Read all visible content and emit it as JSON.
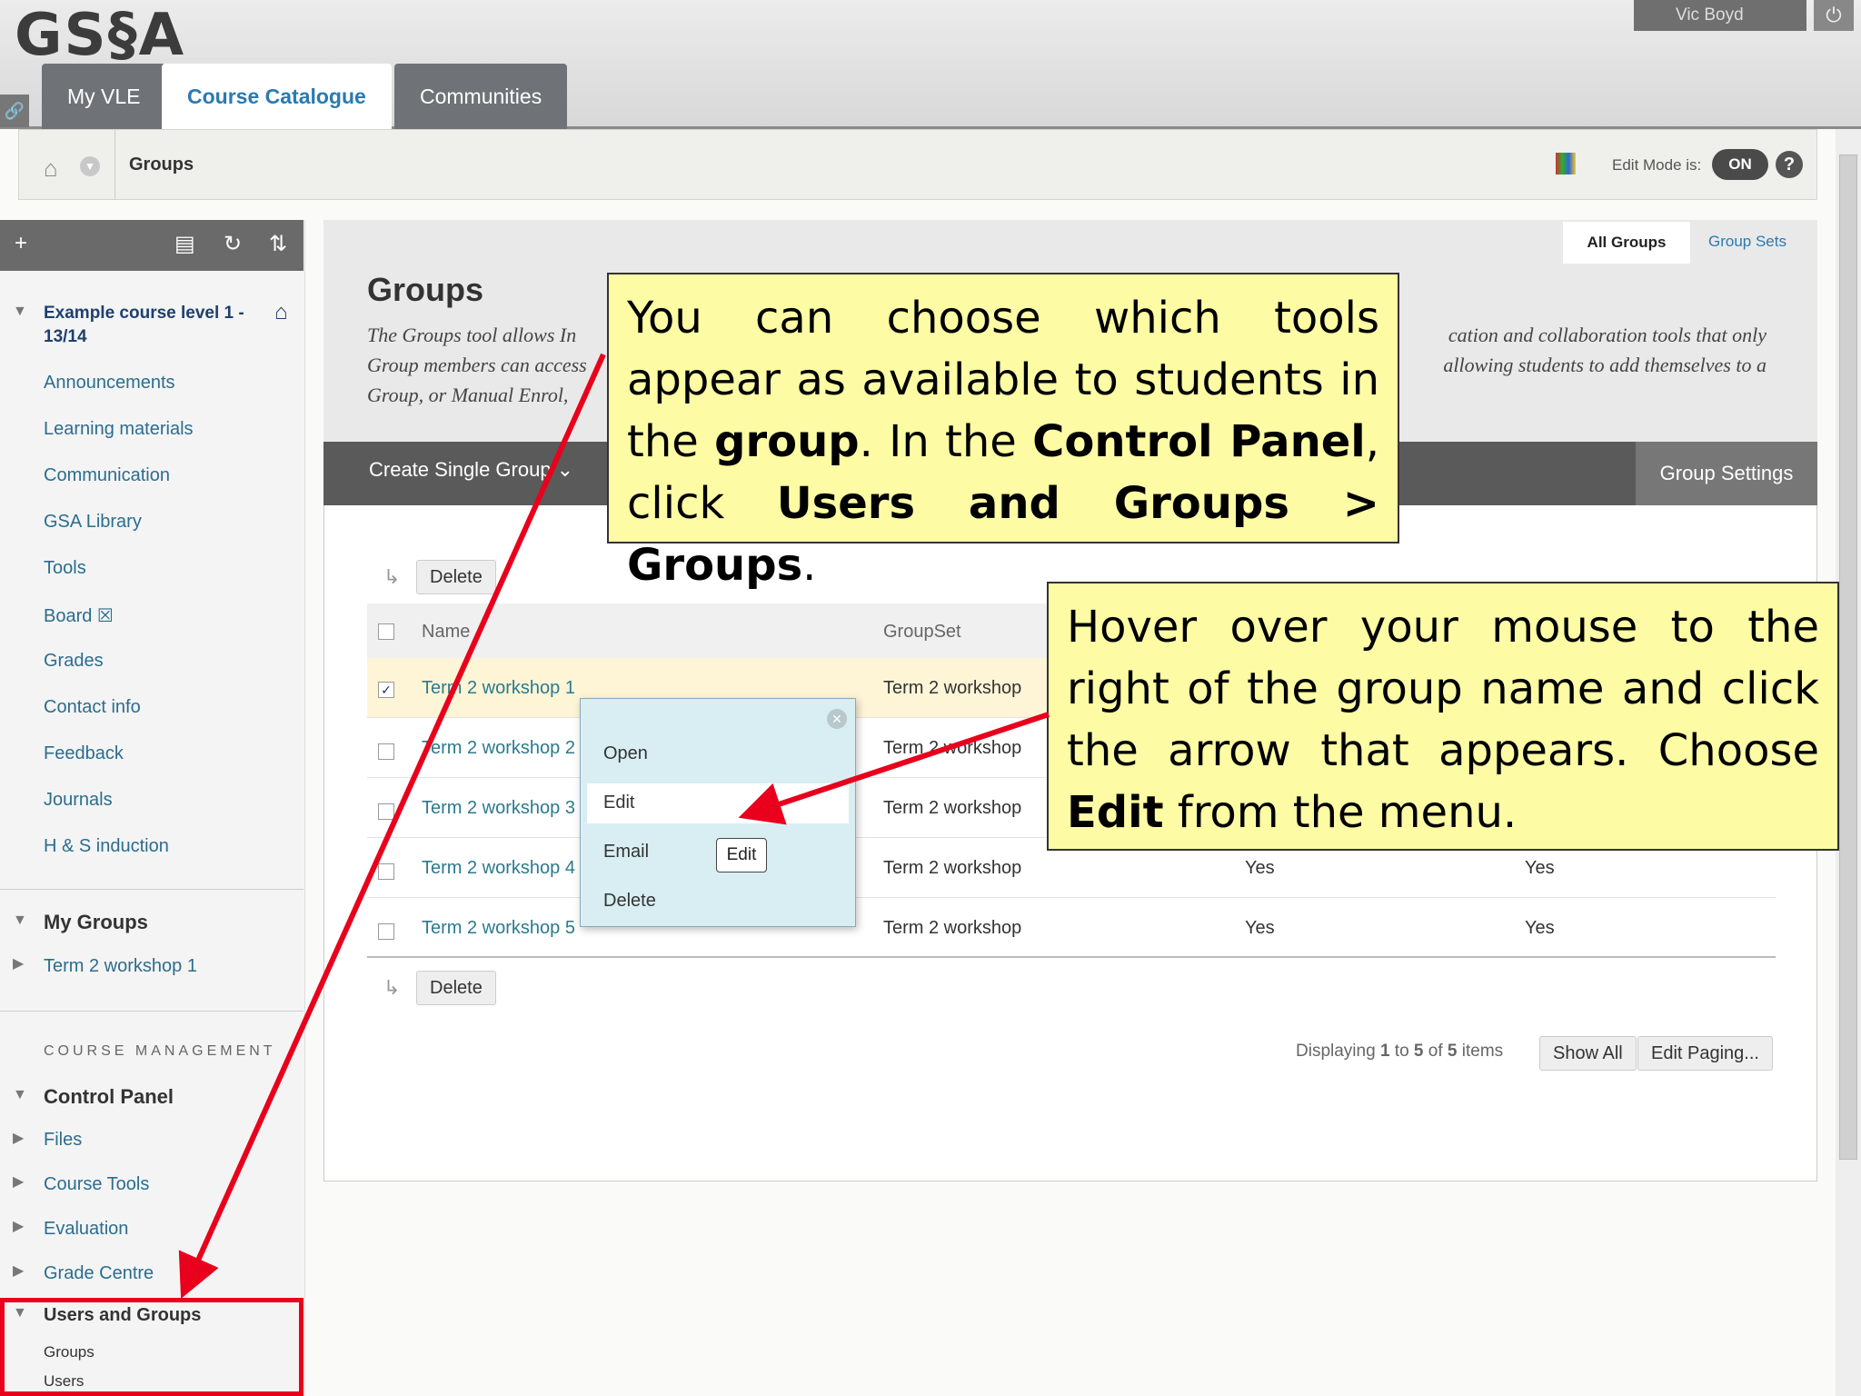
{
  "header": {
    "logo": "GS§A",
    "tabs": [
      "My VLE",
      "Course Catalogue",
      "Communities"
    ],
    "user": "Vic Boyd",
    "power_icon": "power-icon"
  },
  "breadcrumb": {
    "current": "Groups",
    "edit_mode_label": "Edit Mode is:",
    "edit_mode_value": "ON",
    "help": "?"
  },
  "sidebar": {
    "course_title_line1": "Example course level 1 -",
    "course_title_line2": "13/14",
    "links": [
      "Announcements",
      "Learning materials",
      "Communication",
      "GSA Library",
      "Tools",
      "Board ☒",
      "Grades",
      "Contact info",
      "Feedback",
      "Journals",
      "H & S induction"
    ],
    "my_groups": "My Groups",
    "my_group_item": "Term 2 workshop 1",
    "course_management": "COURSE MANAGEMENT",
    "control_panel": "Control Panel",
    "cp_items": [
      "Files",
      "Course Tools",
      "Evaluation",
      "Grade Centre",
      "Users and Groups"
    ],
    "sub_items": [
      "Groups",
      "Users"
    ]
  },
  "main": {
    "title": "Groups",
    "desc_line1": "The Groups tool allows In",
    "desc_line1_end": "cation and collaboration tools that only",
    "desc_line2": "Group members can access",
    "desc_line2_end": "allowing students to add themselves to a",
    "desc_line3": "Group, or Manual Enrol,",
    "tab_all": "All Groups",
    "tab_sets": "Group Sets",
    "create": "Create Single Group ⌄",
    "settings": "Group Settings",
    "delete": "Delete",
    "col_name": "Name",
    "col_groupset": "GroupSet",
    "rows": [
      {
        "name": "Term 2 workshop 1",
        "set": "Term 2 workshop",
        "c3": "",
        "c4": "",
        "checked": true
      },
      {
        "name": "Term 2 workshop 2",
        "set": "Term 2 workshop",
        "c3": "",
        "c4": "",
        "checked": false
      },
      {
        "name": "Term 2 workshop 3",
        "set": "Term 2 workshop",
        "c3": "",
        "c4": "",
        "checked": false
      },
      {
        "name": "Term 2 workshop 4",
        "set": "Term 2 workshop",
        "c3": "Yes",
        "c4": "Yes",
        "checked": false
      },
      {
        "name": "Term 2 workshop 5",
        "set": "Term 2 workshop",
        "c3": "Yes",
        "c4": "Yes",
        "checked": false
      }
    ],
    "paging_prefix": "Displaying ",
    "paging_from": "1",
    "paging_mid": " to ",
    "paging_to": "5",
    "paging_of": " of ",
    "paging_total": "5",
    "paging_suffix": " items",
    "show_all": "Show All",
    "edit_paging": "Edit Paging..."
  },
  "context_menu": {
    "items": [
      "Open",
      "Edit",
      "Email",
      "Delete"
    ],
    "tooltip": "Edit"
  },
  "callouts": {
    "one": {
      "p1": "You can choose which tools appear as available to students in the ",
      "b1": "group",
      "p2": ". In the ",
      "b2": "Control Panel",
      "p3": ", click ",
      "b3": "Users and Groups > Groups",
      "p4": "."
    },
    "two": {
      "p1": "Hover over your mouse to the right of the group name and click the arrow that appears. Choose ",
      "b1": "Edit",
      "p2": " from the menu."
    }
  },
  "colors": {
    "accent": "#2a7ab0",
    "callout_bg": "#fdfca5",
    "highlight": "#e8001c",
    "menu_bg": "#d8eef2"
  }
}
